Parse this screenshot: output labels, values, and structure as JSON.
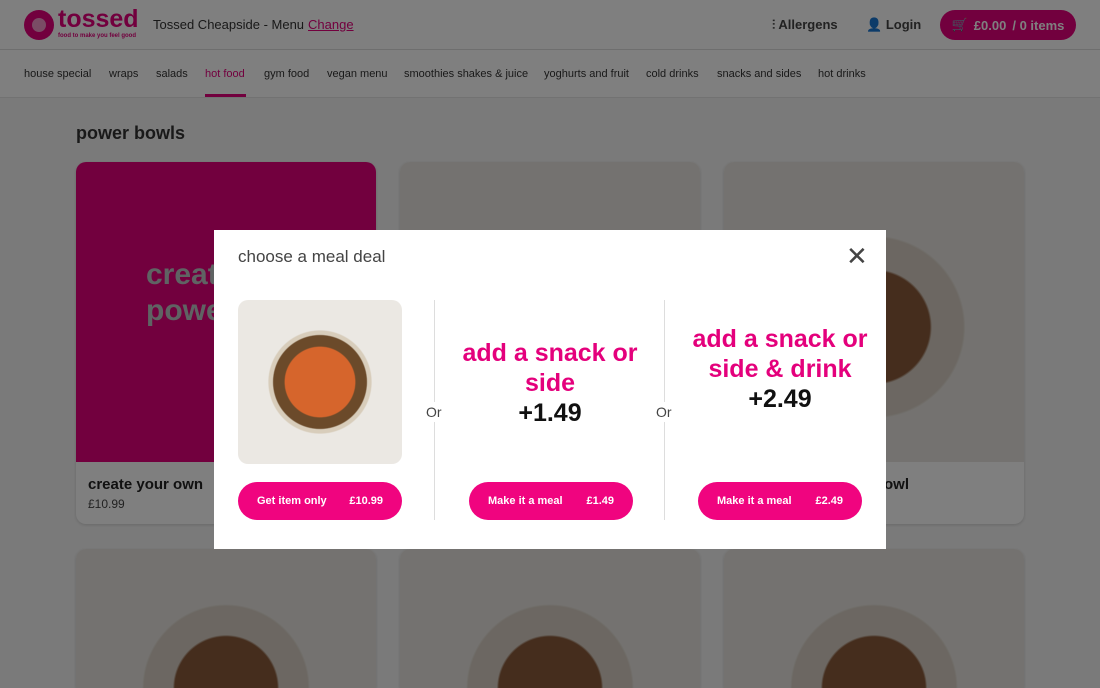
{
  "header": {
    "logo_text": "tossed",
    "logo_tagline": "food to make you feel good",
    "store": "Tossed Cheapside - Menu",
    "change_link": "Change",
    "allergens": "Allergens",
    "login": "Login",
    "cart_total": "£0.00",
    "cart_items": "/ 0 items"
  },
  "nav": [
    "house special",
    "wraps",
    "salads",
    "hot food",
    "gym food",
    "vegan menu",
    "smoothies shakes & juice",
    "yoghurts and fruit",
    "cold drinks",
    "snacks and sides",
    "hot drinks"
  ],
  "nav_active": "hot food",
  "section_title": "power bowls",
  "cards": [
    {
      "image_text": "create your power",
      "title": "create your own",
      "price": "£10.99"
    },
    {
      "title": "",
      "price": ""
    },
    {
      "title_fragment": "owl"
    }
  ],
  "modal": {
    "title": "choose a meal deal",
    "or_label": "Or",
    "options": [
      {
        "button_label": "Get item only",
        "button_price": "£10.99"
      },
      {
        "heading": "add a snack or side",
        "price": "+1.49",
        "button_label": "Make it a meal",
        "button_price": "£1.49"
      },
      {
        "heading": "add a snack or side & drink",
        "price": "+2.49",
        "button_label": "Make it a meal",
        "button_price": "£2.49"
      }
    ]
  },
  "colors": {
    "brand": "#e4007c",
    "overlay": "rgba(0,0,0,0.5)"
  }
}
